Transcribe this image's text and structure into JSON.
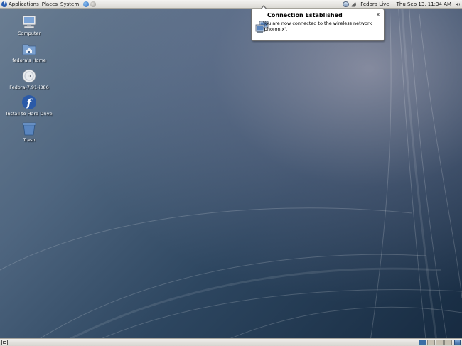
{
  "top_panel": {
    "menus": [
      {
        "label": "Applications"
      },
      {
        "label": "Places"
      },
      {
        "label": "System"
      }
    ],
    "launchers": [
      {
        "icon": "web-browser-icon"
      },
      {
        "icon": "email-icon"
      }
    ],
    "tray_icons": [
      "network-manager-icon",
      "notification-icon"
    ],
    "user": "Fedora Live",
    "clock": "Thu Sep 13, 11:34 AM",
    "volume_icon": "speaker-icon"
  },
  "notification": {
    "title": "Connection Established",
    "body": "You are now connected to the wireless network 'phoronix'.",
    "close_label": "×",
    "icon": "network-computers-icon"
  },
  "desktop_icons": [
    {
      "label": "Computer",
      "icon": "computer-icon"
    },
    {
      "label": "fedora's Home",
      "icon": "home-folder-icon"
    },
    {
      "label": "Fedora-7.91-i386",
      "icon": "optical-disc-icon"
    },
    {
      "label": "Install to Hard Drive",
      "icon": "fedora-installer-icon"
    },
    {
      "label": "Trash",
      "icon": "trash-icon"
    }
  ],
  "bottom_panel": {
    "workspaces": [
      {
        "name": "workspace-1",
        "active": true
      },
      {
        "name": "workspace-2",
        "active": false
      },
      {
        "name": "workspace-3",
        "active": false
      },
      {
        "name": "workspace-4",
        "active": false
      }
    ]
  },
  "colors": {
    "panel": "#dcdad5",
    "desktop_blue": "#2d4660",
    "active_workspace": "#3a6ea5"
  }
}
